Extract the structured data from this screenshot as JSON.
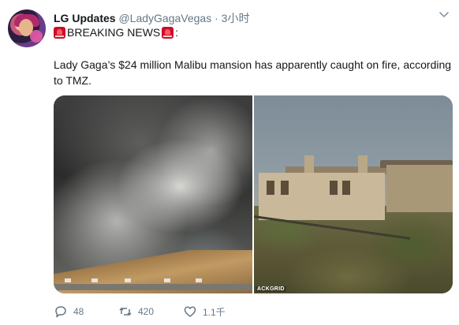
{
  "tweet": {
    "author_name": "LG Updates",
    "handle": "@LadyGagaVegas",
    "separator": "·",
    "time": "3小时",
    "breaking_text": "BREAKING NEWS",
    "breaking_suffix": ":",
    "text": "Lady Gaga’s $24 million Malibu mansion has apparently caught on fire, according to TMZ.",
    "photo_credit": "ACKGRID"
  },
  "actions": {
    "reply_count": "48",
    "retweet_count": "420",
    "like_count": "1.1千"
  },
  "icons": {
    "breaking": "siren-icon",
    "reply": "reply-icon",
    "retweet": "retweet-icon",
    "like": "heart-icon",
    "menu": "chevron-down-icon"
  },
  "colors": {
    "text": "#14171a",
    "muted": "#657786",
    "siren": "#c8102e"
  }
}
